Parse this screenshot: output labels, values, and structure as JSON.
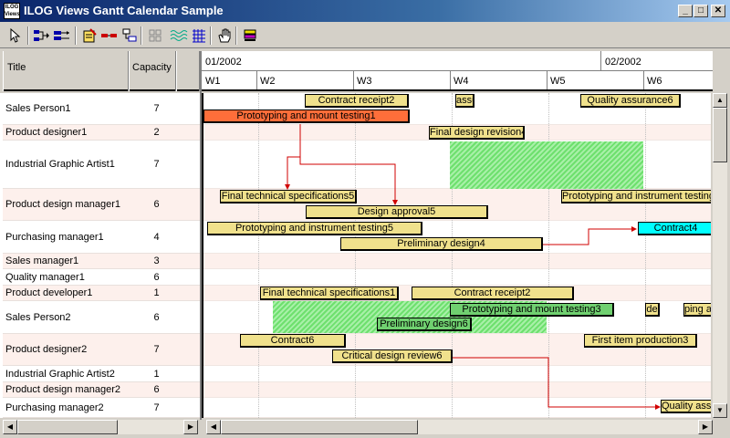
{
  "window": {
    "title": "ILOG Views Gantt Calendar Sample",
    "icon_text": "ILOG Views",
    "buttons": {
      "minimize": "_",
      "maximize": "□",
      "close": "✕"
    }
  },
  "toolbar": {
    "icons": [
      "select-arrow-icon",
      "link-icon",
      "unlink-icon",
      "edit-icon",
      "row-icon",
      "tree-icon",
      "grid-icon",
      "wave-icon",
      "table-icon",
      "hand-icon",
      "color-icon"
    ]
  },
  "table": {
    "headers": {
      "title": "Title",
      "capacity": "Capacity"
    },
    "rows": [
      {
        "title": "Sales Person1",
        "capacity": "7"
      },
      {
        "title": "Product designer1",
        "capacity": "2"
      },
      {
        "title": "Industrial Graphic Artist1",
        "capacity": "7"
      },
      {
        "title": "Product design manager1",
        "capacity": "6"
      },
      {
        "title": "Purchasing manager1",
        "capacity": "4"
      },
      {
        "title": "Sales manager1",
        "capacity": "3"
      },
      {
        "title": "Quality manager1",
        "capacity": "6"
      },
      {
        "title": "Product developer1",
        "capacity": "1"
      },
      {
        "title": "Sales Person2",
        "capacity": "6"
      },
      {
        "title": "Product designer2",
        "capacity": "7"
      },
      {
        "title": "Industrial Graphic Artist2",
        "capacity": "1"
      },
      {
        "title": "Product design manager2",
        "capacity": "6"
      },
      {
        "title": "Purchasing manager2",
        "capacity": "7"
      }
    ]
  },
  "timescale": {
    "months": [
      "01/2002",
      "02/2002"
    ],
    "weeks": [
      "W1",
      "W2",
      "W3",
      "W4",
      "W5",
      "W6"
    ]
  },
  "activities": [
    {
      "label": "Contract receipt2"
    },
    {
      "label": "assu"
    },
    {
      "label": "Quality assurance6"
    },
    {
      "label": "Prototyping and mount testing1",
      "color": "orange"
    },
    {
      "label": "Final design revision4"
    },
    {
      "label": "Final technical specifications5"
    },
    {
      "label": "Prototyping and instrument testing"
    },
    {
      "label": "Design approval5"
    },
    {
      "label": "Prototyping and instrument testing5"
    },
    {
      "label": "Contract4",
      "color": "cyan"
    },
    {
      "label": "Preliminary design4"
    },
    {
      "label": "Final technical specifications1"
    },
    {
      "label": "Contract receipt2"
    },
    {
      "label": "Prototyping and mount testing3",
      "color": "green"
    },
    {
      "label": "de"
    },
    {
      "label": "ping an"
    },
    {
      "label": "Preliminary design6",
      "color": "green"
    },
    {
      "label": "Contract6"
    },
    {
      "label": "First item production3"
    },
    {
      "label": "Critical design review6"
    },
    {
      "label": "Quality assu"
    }
  ],
  "colors": {
    "activity": "#f0e18c",
    "orange": "#ff6e3a",
    "cyan": "#00ffff",
    "link": "#d00000",
    "hatch": "#6ee06e"
  }
}
